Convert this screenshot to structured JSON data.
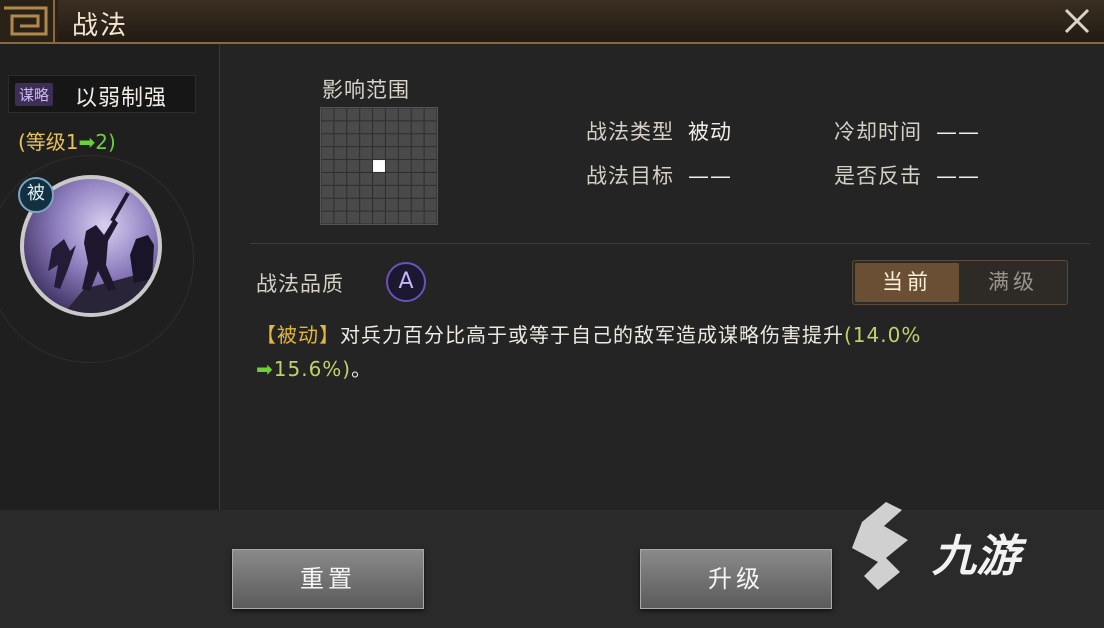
{
  "window": {
    "title": "战法"
  },
  "skill": {
    "type_tag": "谋略",
    "name": "以弱制强",
    "level_prefix": "(等级1",
    "level_arrow": "➡",
    "level_suffix": "2)",
    "passive_badge": "被"
  },
  "range": {
    "label": "影响范围",
    "grid_size": 9,
    "center": [
      4,
      4
    ],
    "highlight_color": "#ffffff"
  },
  "stats": {
    "type_label": "战法类型",
    "type_value": "被动",
    "cooldown_label": "冷却时间",
    "cooldown_value": "——",
    "target_label": "战法目标",
    "target_value": "——",
    "counter_label": "是否反击",
    "counter_value": "——"
  },
  "quality": {
    "label": "战法品质",
    "grade": "A",
    "color": "#6a52b8"
  },
  "toggle": {
    "current": "当前",
    "max": "满级"
  },
  "description": {
    "tag": "【被动】",
    "text": "对兵力百分比高于或等于自己的敌军造成谋略伤害提升",
    "value_open": "(14.0%",
    "arrow": "➡",
    "value_close": "15.6%)",
    "end": "。"
  },
  "buttons": {
    "reset": "重置",
    "upgrade": "升级"
  },
  "watermark": {
    "text": "九游"
  }
}
